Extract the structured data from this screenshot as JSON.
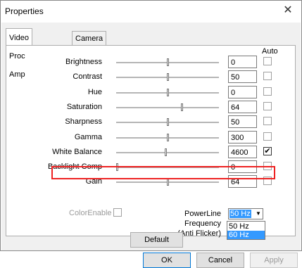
{
  "window": {
    "title": "Properties",
    "close_label": "✕"
  },
  "tabs": [
    {
      "label": "Video Proc Amp"
    },
    {
      "label": "Camera Control"
    }
  ],
  "auto_header": "Auto",
  "rows": [
    {
      "label": "Brightness",
      "value": "0",
      "auto": false,
      "level": 0.5
    },
    {
      "label": "Contrast",
      "value": "50",
      "auto": false,
      "level": 0.5
    },
    {
      "label": "Hue",
      "value": "0",
      "auto": false,
      "level": 0.5
    },
    {
      "label": "Saturation",
      "value": "64",
      "auto": false,
      "level": 0.64
    },
    {
      "label": "Sharpness",
      "value": "50",
      "auto": false,
      "level": 0.5
    },
    {
      "label": "Gamma",
      "value": "300",
      "auto": false,
      "level": 0.5
    },
    {
      "label": "White Balance",
      "value": "4600",
      "auto": true,
      "level": 0.48
    },
    {
      "label": "Backlight Comp",
      "value": "0",
      "auto": false,
      "level": 0.0
    },
    {
      "label": "Gain",
      "value": "64",
      "auto": false,
      "level": 0.5
    }
  ],
  "color_enable": {
    "label": "ColorEnable",
    "checked": false
  },
  "powerline": {
    "label_line1": "PowerLine Frequency",
    "label_line2": "(Anti Flicker)",
    "selected": "50 Hz",
    "options": [
      "50 Hz",
      "60 Hz"
    ],
    "highlighted_option": "60 Hz"
  },
  "buttons": {
    "default": "Default",
    "ok": "OK",
    "cancel": "Cancel",
    "apply": "Apply"
  },
  "colors": {
    "highlight_border": "#e22222",
    "selection": "#3399ff"
  }
}
